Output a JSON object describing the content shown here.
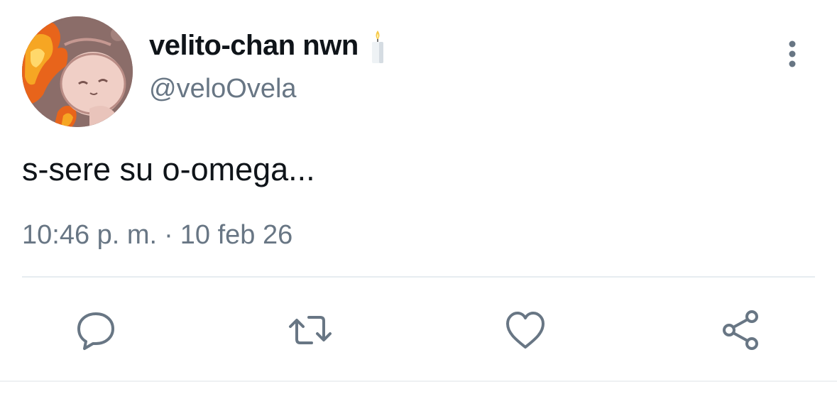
{
  "user": {
    "display_name": "velito-chan nwn",
    "handle": "@veloOvela",
    "name_emoji_icon": "candle-icon"
  },
  "tweet": {
    "text": "s-sere su o-omega...",
    "time": "10:46 p. m.",
    "separator": "·",
    "date": "10 feb 26"
  },
  "actions": {
    "reply_icon": "reply-icon",
    "retweet_icon": "retweet-icon",
    "like_icon": "heart-icon",
    "share_icon": "share-icon"
  },
  "menu": {
    "more_icon": "more-vertical-icon"
  },
  "colors": {
    "text_primary": "#0f1419",
    "text_secondary": "#687684",
    "icon": "#687684",
    "divider": "#e6ecf0"
  }
}
